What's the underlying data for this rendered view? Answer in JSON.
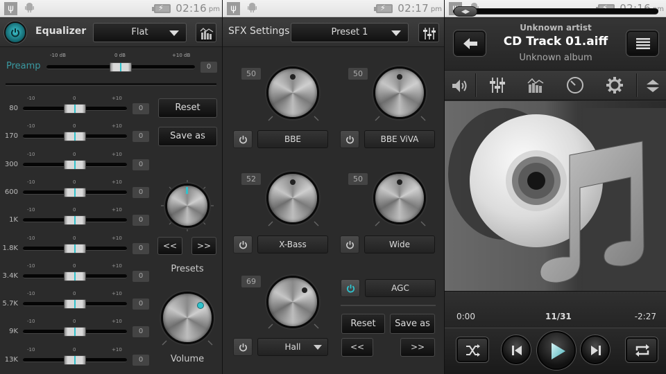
{
  "status_bars": [
    {
      "time": "02:16",
      "ampm": "pm"
    },
    {
      "time": "02:17",
      "ampm": "pm"
    },
    {
      "time": "02:16",
      "ampm": "pm"
    }
  ],
  "equalizer": {
    "title": "Equalizer",
    "power_on": true,
    "preset_dropdown": "Flat",
    "preamp": {
      "label": "Preamp",
      "tick_min": "-10 dB",
      "tick_mid": "0 dB",
      "tick_max": "+10 dB",
      "value": "0",
      "position": 0.5
    },
    "band_ticks": {
      "min": "-10",
      "mid": "0",
      "max": "+10"
    },
    "bands": [
      {
        "freq": "80",
        "value": "0",
        "position": 0.5
      },
      {
        "freq": "170",
        "value": "0",
        "position": 0.5
      },
      {
        "freq": "300",
        "value": "0",
        "position": 0.5
      },
      {
        "freq": "600",
        "value": "0",
        "position": 0.5
      },
      {
        "freq": "1K",
        "value": "0",
        "position": 0.5
      },
      {
        "freq": "1.8K",
        "value": "0",
        "position": 0.5
      },
      {
        "freq": "3.4K",
        "value": "0",
        "position": 0.5
      },
      {
        "freq": "5.7K",
        "value": "0",
        "position": 0.5
      },
      {
        "freq": "9K",
        "value": "0",
        "position": 0.5
      },
      {
        "freq": "13K",
        "value": "0",
        "position": 0.5
      }
    ],
    "reset_label": "Reset",
    "save_as_label": "Save as",
    "prev_label": "<<",
    "next_label": ">>",
    "presets_label": "Presets",
    "volume_label": "Volume"
  },
  "sfx": {
    "title": "SFX Settings",
    "preset_dropdown": "Preset 1",
    "effects": [
      {
        "name": "BBE",
        "value": "50",
        "enabled": false
      },
      {
        "name": "BBE ViVA",
        "value": "50",
        "enabled": false
      },
      {
        "name": "X-Bass",
        "value": "52",
        "enabled": false
      },
      {
        "name": "Wide",
        "value": "50",
        "enabled": false
      }
    ],
    "reverb": {
      "value": "69",
      "preset": "Hall",
      "enabled": false
    },
    "agc": {
      "label": "AGC",
      "enabled": true
    },
    "reset_label": "Reset",
    "save_as_label": "Save as",
    "prev_label": "<<",
    "next_label": ">>"
  },
  "player": {
    "artist": "Unknown artist",
    "title": "CD Track 01.aiff",
    "album": "Unknown album",
    "elapsed": "0:00",
    "track_index": "11/31",
    "remaining": "-2:27",
    "progress": 0.0,
    "seek_glyph": "◀▶"
  },
  "colors": {
    "accent": "#2fc2cc",
    "preamp_label": "#3a99a1"
  }
}
